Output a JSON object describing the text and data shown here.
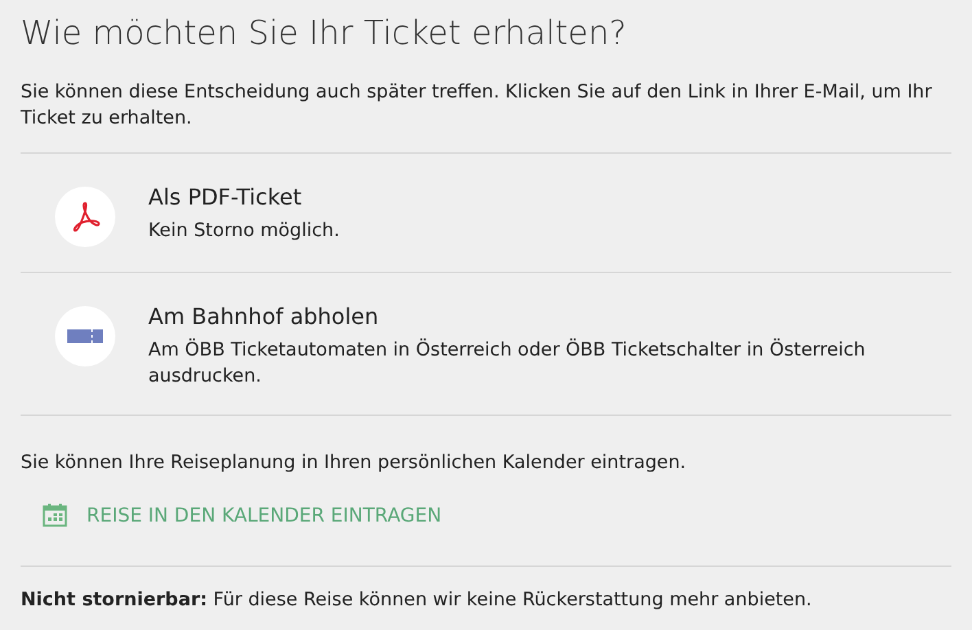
{
  "heading": "Wie möchten Sie Ihr Ticket erhalten?",
  "intro": "Sie können diese Entscheidung auch später treffen. Klicken Sie auf den Link in Ihrer E-Mail, um Ihr Ticket zu erhalten.",
  "options": [
    {
      "kind": "pdf",
      "title": "Als PDF-Ticket",
      "description": "Kein Storno möglich."
    },
    {
      "kind": "station",
      "title": "Am Bahnhof abholen",
      "description": "Am ÖBB Ticketautomaten in Österreich oder ÖBB Ticketschalter in Österreich ausdrucken."
    }
  ],
  "calendar_note": "Sie können Ihre Reiseplanung in Ihren persönlichen Kalender eintragen.",
  "calendar_link": "REISE IN DEN KALENDER EINTRAGEN",
  "footer": "**Nicht stornierbar:** Für diese Reise können wir keine Rückerstattung mehr anbieten."
}
